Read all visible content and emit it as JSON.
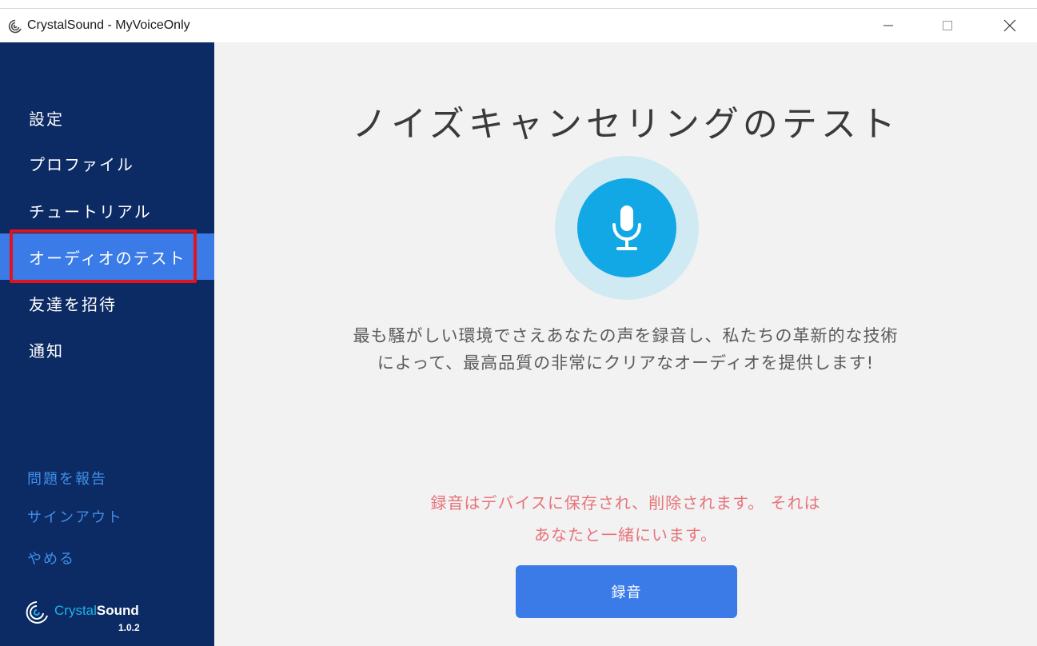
{
  "window": {
    "title": "CrystalSound - MyVoiceOnly",
    "controls": [
      "minimize",
      "maximize",
      "close"
    ]
  },
  "sidebar": {
    "items": [
      {
        "label": "設定"
      },
      {
        "label": "プロファイル"
      },
      {
        "label": "チュートリアル"
      },
      {
        "label": "オーディオのテスト",
        "active": true
      },
      {
        "label": "友達を招待"
      },
      {
        "label": "通知"
      }
    ],
    "secondary": [
      {
        "label": "問題を報告"
      },
      {
        "label": "サインアウト"
      },
      {
        "label": "やめる"
      }
    ],
    "brand": {
      "name_part1": "Crystal",
      "name_part2": "Sound",
      "version": "1.0.2"
    }
  },
  "main": {
    "title": "ノイズキャンセリングのテスト",
    "description_line1": "最も騒がしい環境でさえあなたの声を録音し、私たちの革新的な技術",
    "description_line2": "によって、最高品質の非常にクリアなオーディオを提供します!",
    "notice_line1": "録音はデバイスに保存され、削除されます。 それは",
    "notice_line2": "あなたと一緒にいます。",
    "record_button": "録音",
    "icon": "microphone-icon"
  },
  "colors": {
    "sidebar_bg": "#0c2a63",
    "accent_blue": "#3a7be8",
    "mic_blue": "#12a8e6",
    "mic_halo": "#cfeaf2",
    "notice_red": "#e8737a",
    "highlight_red": "#e0141c",
    "secondary_link": "#3f8fe8"
  }
}
